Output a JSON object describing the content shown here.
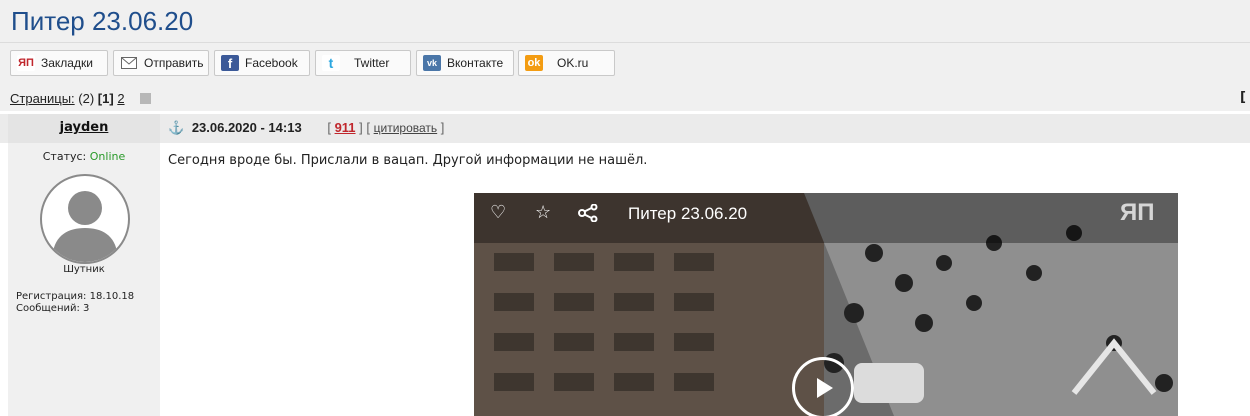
{
  "page": {
    "title": "Питер 23.06.20"
  },
  "share": {
    "bookmarks": {
      "icon": "yap-logo-icon",
      "label": "Закладки"
    },
    "send": {
      "icon": "envelope-icon",
      "label": "Отправить"
    },
    "facebook": {
      "icon": "facebook-icon",
      "label": "Facebook"
    },
    "twitter": {
      "icon": "twitter-icon",
      "label": "Twitter"
    },
    "vkontakte": {
      "icon": "vk-icon",
      "label": "Вконтакте"
    },
    "ok": {
      "icon": "ok-icon",
      "label": "OK.ru"
    }
  },
  "pager": {
    "label": "Страницы:",
    "count": "(2)",
    "current": "[1]",
    "page2": "2",
    "right_bracket": "["
  },
  "post": {
    "author": "jayden",
    "date": "23.06.2020 - 14:13",
    "rating": "911",
    "quote_label": "цитировать",
    "text": "Сегодня вроде бы. Прислали в вацап. Другой информации не нашёл."
  },
  "user": {
    "status_label": "Статус:",
    "status_value": "Online",
    "rank": "Шутник",
    "registration": "Регистрация: 18.10.18",
    "messages": "Сообщений: 3"
  },
  "video": {
    "title": "Питер 23.06.20",
    "watermark": "ЯП"
  },
  "colors": {
    "title": "#1f4e8c",
    "online": "#2a9a2a",
    "rating": "#c0262c"
  }
}
